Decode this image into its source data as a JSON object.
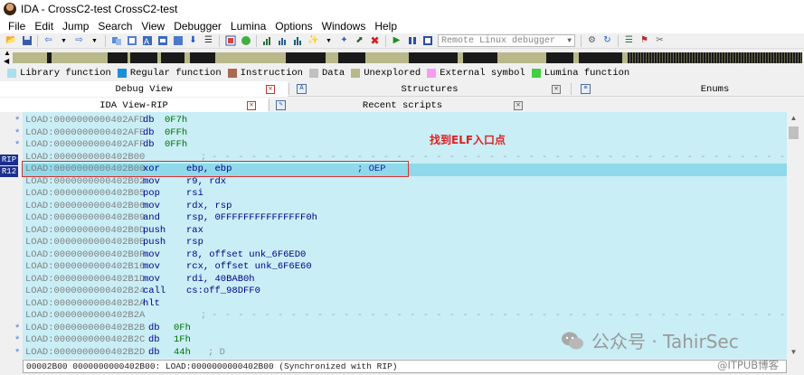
{
  "window": {
    "title": "IDA - CrossC2-test CrossC2-test"
  },
  "menu": [
    "File",
    "Edit",
    "Jump",
    "Search",
    "View",
    "Debugger",
    "Lumina",
    "Options",
    "Windows",
    "Help"
  ],
  "toolbar": {
    "debugger_combo": "Remote Linux debugger",
    "icons": [
      "open-icon",
      "save-icon",
      "back-icon",
      "dropdown-icon",
      "forward-icon",
      "dropdown-icon",
      "copy-icon",
      "paste-icon",
      "find-icon",
      "find-next-icon",
      "find-text-icon",
      "search-binary-icon",
      "down-arrow-icon",
      "list-icon",
      "image-icon",
      "green-circle-icon",
      "chart-icon",
      "chart2-icon",
      "chart3-icon",
      "wand-icon",
      "dropdown-icon",
      "wand2-icon",
      "pin-icon",
      "stop-icon",
      "play-icon",
      "pause-icon",
      "stop-square-icon"
    ]
  },
  "legend": [
    {
      "label": "Library function",
      "color": "#a8e0f0"
    },
    {
      "label": "Regular function",
      "color": "#1a8fdc"
    },
    {
      "label": "Instruction",
      "color": "#a86a50"
    },
    {
      "label": "Data",
      "color": "#c0c0c0"
    },
    {
      "label": "Unexplored",
      "color": "#b8b88a"
    },
    {
      "label": "External symbol",
      "color": "#f79df0"
    },
    {
      "label": "Lumina function",
      "color": "#40d040"
    }
  ],
  "tabs_top": [
    {
      "label": "Debug View"
    },
    {
      "label": "Structures"
    },
    {
      "label": "Enums"
    }
  ],
  "tabs_second": [
    {
      "label": "IDA View-RIP"
    },
    {
      "label": "Recent scripts"
    }
  ],
  "annotation": "找到ELF入口点",
  "registers": [
    "RIP",
    "R12"
  ],
  "listing": [
    {
      "addr": "LOAD:0000000000402AFD",
      "mn": "db",
      "op": "0F7h",
      "op_num": true,
      "dot": true
    },
    {
      "addr": "LOAD:0000000000402AFE",
      "mn": "db",
      "op": "0FFh",
      "op_num": true,
      "dot": true
    },
    {
      "addr": "LOAD:0000000000402AFF",
      "mn": "db",
      "op": "0FFh",
      "op_num": true,
      "dot": true
    },
    {
      "addr": "LOAD:0000000000402B00",
      "mn": ";",
      "op": "",
      "sep": true
    },
    {
      "addr": "LOAD:0000000000402B00",
      "mn": "xor",
      "op": "ebp, ebp",
      "cmt": "; OEP",
      "highlight": true
    },
    {
      "addr": "LOAD:0000000000402B02",
      "mn": "mov",
      "op": "r9, rdx"
    },
    {
      "addr": "LOAD:0000000000402B05",
      "mn": "pop",
      "op": "rsi"
    },
    {
      "addr": "LOAD:0000000000402B06",
      "mn": "mov",
      "op": "rdx, rsp"
    },
    {
      "addr": "LOAD:0000000000402B09",
      "mn": "and",
      "op": "rsp, 0FFFFFFFFFFFFFFF0h",
      "op_num_suffix": true
    },
    {
      "addr": "LOAD:0000000000402B0D",
      "mn": "push",
      "op": "rax"
    },
    {
      "addr": "LOAD:0000000000402B0E",
      "mn": "push",
      "op": "rsp"
    },
    {
      "addr": "LOAD:0000000000402B0F",
      "mn": "mov",
      "op": "r8, offset unk_6F6ED0"
    },
    {
      "addr": "LOAD:0000000000402B16",
      "mn": "mov",
      "op": "rcx, offset unk_6F6E60"
    },
    {
      "addr": "LOAD:0000000000402B1D",
      "mn": "mov",
      "op": "rdi, 40BAB0h",
      "op_num_suffix": true
    },
    {
      "addr": "LOAD:0000000000402B24",
      "mn": "call",
      "op": "cs:off_98DFF0"
    },
    {
      "addr": "LOAD:0000000000402B2A",
      "mn": "hlt",
      "op": ""
    },
    {
      "addr": "LOAD:0000000000402B2A",
      "mn": ";",
      "op": "",
      "sep": true
    },
    {
      "addr": "LOAD:0000000000402B2B",
      "mn": "db",
      "op": "0Fh",
      "op_num": true,
      "dot": true,
      "narrow": true
    },
    {
      "addr": "LOAD:0000000000402B2C",
      "mn": "db",
      "op": "1Fh",
      "op_num": true,
      "dot": true,
      "narrow": true
    },
    {
      "addr": "LOAD:0000000000402B2D",
      "mn": "db",
      "op": "44h",
      "op_num": true,
      "cmt_inline": "; D",
      "dot": true,
      "narrow": true
    }
  ],
  "status": "00002B00 0000000000402B00: LOAD:0000000000402B00 (Synchronized with RIP)",
  "watermark": {
    "main": "公众号 · TahirSec",
    "corner": "@ITPUB博客"
  }
}
